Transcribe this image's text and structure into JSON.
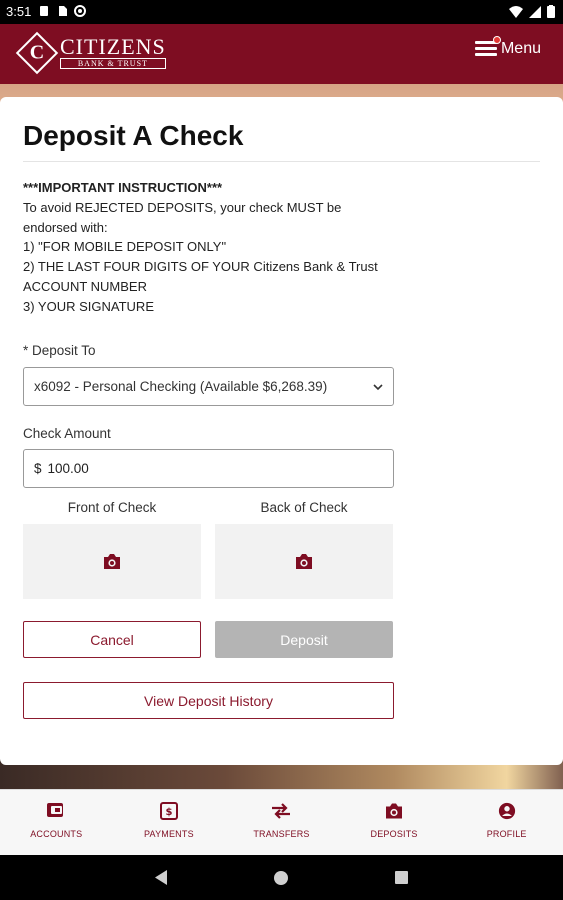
{
  "status_bar": {
    "time": "3:51"
  },
  "header": {
    "logo_letter": "C",
    "logo_name": "CITIZENS",
    "logo_sub": "BANK & TRUST",
    "menu_label": "Menu"
  },
  "page": {
    "title": "Deposit A Check",
    "instructions": [
      "***IMPORTANT INSTRUCTION***",
      "To avoid REJECTED DEPOSITS, your check MUST be",
      "endorsed with:",
      "1) \"FOR MOBILE DEPOSIT ONLY\"",
      "2) THE LAST FOUR DIGITS OF YOUR Citizens Bank & Trust",
      "ACCOUNT NUMBER",
      "3) YOUR SIGNATURE"
    ],
    "deposit_to_label": "* Deposit To",
    "deposit_to_value": "x6092 - Personal Checking (Available $6,268.39)",
    "amount_label": "Check Amount",
    "amount_currency": "$",
    "amount_value": "100.00",
    "front_label": "Front of Check",
    "back_label": "Back of Check",
    "cancel_label": "Cancel",
    "deposit_label": "Deposit",
    "history_label": "View Deposit History"
  },
  "bottom_nav": {
    "items": [
      {
        "label": "ACCOUNTS",
        "icon": "accounts-icon"
      },
      {
        "label": "PAYMENTS",
        "icon": "payments-icon"
      },
      {
        "label": "TRANSFERS",
        "icon": "transfers-icon"
      },
      {
        "label": "DEPOSITS",
        "icon": "camera-icon"
      },
      {
        "label": "PROFILE",
        "icon": "profile-icon"
      }
    ]
  },
  "colors": {
    "brand": "#7e0d22",
    "disabled_button": "#b4b4b4"
  }
}
